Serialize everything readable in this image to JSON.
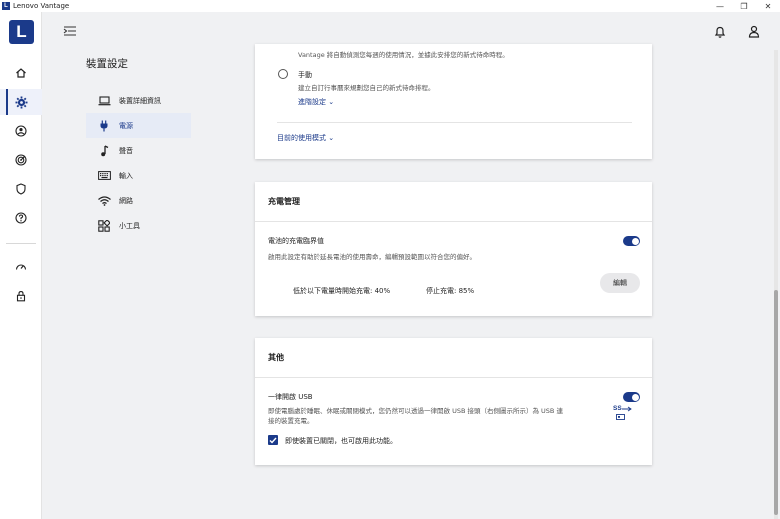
{
  "window": {
    "title": "Lenovo Vantage"
  },
  "rail": {
    "logo": "L"
  },
  "subnav": {
    "title": "裝置設定",
    "items": [
      {
        "label": "裝置詳細資訊",
        "icon": "laptop-icon"
      },
      {
        "label": "電源",
        "icon": "plug-icon"
      },
      {
        "label": "聲音",
        "icon": "music-note-icon"
      },
      {
        "label": "輸入",
        "icon": "keyboard-icon"
      },
      {
        "label": "網路",
        "icon": "wifi-icon"
      },
      {
        "label": "小工具",
        "icon": "widgets-icon"
      }
    ]
  },
  "power_card": {
    "partial_text": "Vantage 將自動偵測您每週的使用情況，並據此安排您的新式待命時程。",
    "manual_label": "手動",
    "manual_desc": "建立自訂行事曆來規劃您自己的新式待命排程。",
    "advanced_link": "進階設定",
    "usage_mode_link": "目前的使用模式"
  },
  "charge_card": {
    "title": "充電管理",
    "threshold_label": "電池的充電臨界值",
    "threshold_desc": "啟用此設定有助於延長電池的使用壽命，編輯預設範圍以符合您的偏好。",
    "threshold_enabled": true,
    "start_label": "低於以下電量時開始充電: 40%",
    "stop_label": "停止充電: 85%",
    "edit_button": "編輯"
  },
  "other_card": {
    "title": "其他",
    "usb_label": "一律開啟 USB",
    "usb_desc_line1": "即使電腦處於睡眠、休眠或關閉模式，您仍然可以透過一律開啟 USB 接頭（右側圖示所示）為 USB 連",
    "usb_desc_line2": "接的裝置充電。",
    "usb_enabled": true,
    "usb_port_icon_text": "SS",
    "checkbox_label": "即使裝置已關閉，也可啟用此功能。",
    "checkbox_checked": true
  },
  "colors": {
    "accent": "#1b3a8a",
    "background": "#f0f1f3",
    "card": "#ffffff"
  }
}
